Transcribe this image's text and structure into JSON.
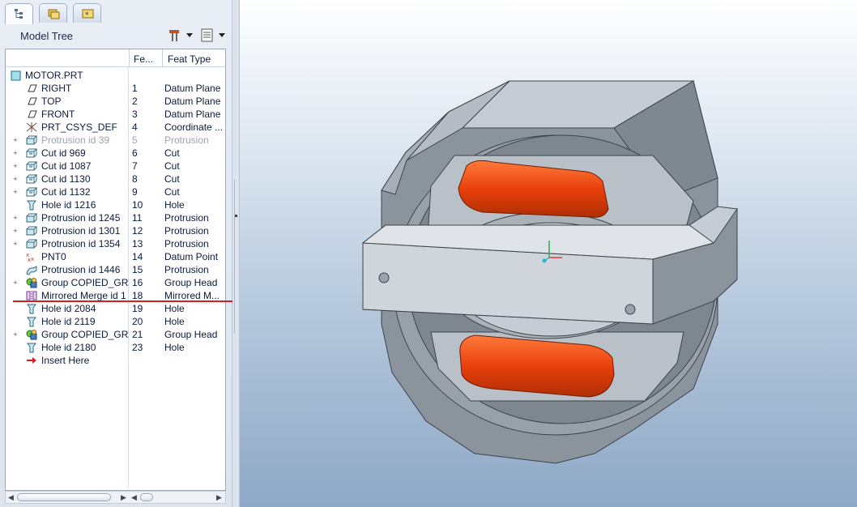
{
  "nav_tabs": [
    {
      "name": "model-tree",
      "icon": "model-tree-icon",
      "active": true
    },
    {
      "name": "folder-browser",
      "icon": "folder-browser-icon",
      "active": false
    },
    {
      "name": "favorites",
      "icon": "favorites-folder-icon",
      "active": false
    }
  ],
  "panel": {
    "title": "Model Tree",
    "settings_icon": "tools-settings-icon",
    "show_icon": "tree-columns-icon"
  },
  "columns": {
    "feat_num": "Fe...",
    "feat_type": "Feat Type"
  },
  "tree": {
    "root": "MOTOR.PRT",
    "rows": [
      {
        "name": "RIGHT",
        "num": "1",
        "type": "Datum Plane",
        "icon": "datum-plane-icon",
        "expandable": false
      },
      {
        "name": "TOP",
        "num": "2",
        "type": "Datum Plane",
        "icon": "datum-plane-icon",
        "expandable": false
      },
      {
        "name": "FRONT",
        "num": "3",
        "type": "Datum Plane",
        "icon": "datum-plane-icon",
        "expandable": false
      },
      {
        "name": "PRT_CSYS_DEF",
        "num": "4",
        "type": "Coordinate ...",
        "icon": "coordinate-system-icon",
        "expandable": false
      },
      {
        "name": "Protrusion id 39",
        "num": "5",
        "type": "Protrusion",
        "icon": "protrusion-icon",
        "expandable": true,
        "suppressed": true
      },
      {
        "name": "Cut id 969",
        "num": "6",
        "type": "Cut",
        "icon": "cut-icon",
        "expandable": true
      },
      {
        "name": "Cut id 1087",
        "num": "7",
        "type": "Cut",
        "icon": "cut-icon",
        "expandable": true
      },
      {
        "name": "Cut id 1130",
        "num": "8",
        "type": "Cut",
        "icon": "cut-icon",
        "expandable": true
      },
      {
        "name": "Cut id 1132",
        "num": "9",
        "type": "Cut",
        "icon": "cut-icon",
        "expandable": true
      },
      {
        "name": "Hole id 1216",
        "num": "10",
        "type": "Hole",
        "icon": "hole-icon",
        "expandable": false
      },
      {
        "name": "Protrusion id 1245",
        "num": "11",
        "type": "Protrusion",
        "icon": "protrusion-icon",
        "expandable": true
      },
      {
        "name": "Protrusion id 1301",
        "num": "12",
        "type": "Protrusion",
        "icon": "protrusion-icon",
        "expandable": true
      },
      {
        "name": "Protrusion id 1354",
        "num": "13",
        "type": "Protrusion",
        "icon": "protrusion-icon",
        "expandable": true
      },
      {
        "name": "PNT0",
        "num": "14",
        "type": "Datum Point",
        "icon": "datum-point-icon",
        "expandable": false
      },
      {
        "name": "Protrusion id 1446",
        "num": "15",
        "type": "Protrusion",
        "icon": "sweep-protrusion-icon",
        "expandable": false
      },
      {
        "name": "Group COPIED_GR",
        "num": "16",
        "type": "Group Head",
        "icon": "group-icon",
        "expandable": true
      },
      {
        "name": "Mirrored Merge id 1",
        "num": "18",
        "type": "Mirrored M...",
        "icon": "mirror-merge-icon",
        "expandable": false
      },
      {
        "name": "Hole id 2084",
        "num": "19",
        "type": "Hole",
        "icon": "hole-icon",
        "expandable": false
      },
      {
        "name": "Hole id 2119",
        "num": "20",
        "type": "Hole",
        "icon": "hole-icon",
        "expandable": false
      },
      {
        "name": "Group COPIED_GR",
        "num": "21",
        "type": "Group Head",
        "icon": "group-icon",
        "expandable": true
      },
      {
        "name": "Hole id 2180",
        "num": "23",
        "type": "Hole",
        "icon": "hole-icon",
        "expandable": false
      },
      {
        "name": "Insert Here",
        "num": "",
        "type": "",
        "icon": "insert-here-arrow-icon",
        "expandable": false
      }
    ]
  },
  "colors": {
    "winding": "#e8400c",
    "core_light": "#c6ccd3",
    "core_dark": "#8b939d",
    "insert_line": "#d42020"
  }
}
